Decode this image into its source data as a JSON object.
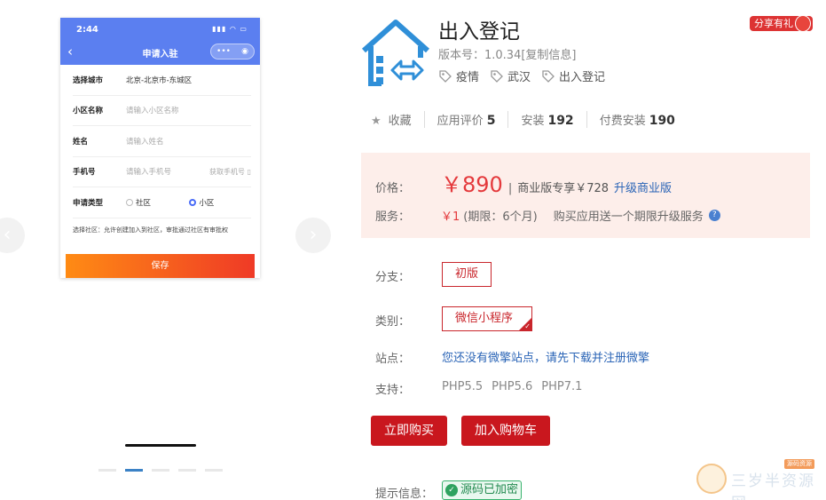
{
  "gallery": {
    "prev_arrow": "‹",
    "next_arrow": "›",
    "phone": {
      "time": "2:44",
      "status_icons": "▮▮▮ ◠ ▭",
      "back_glyph": "‹",
      "title": "申请入驻",
      "capsule_more": "•••",
      "capsule_close": "◉",
      "rows": [
        {
          "label": "选择城市",
          "value": "北京-北京市-东城区",
          "type": "value"
        },
        {
          "label": "小区名称",
          "value": "请输入小区名称",
          "type": "placeholder"
        },
        {
          "label": "姓名",
          "value": "请输入姓名",
          "type": "placeholder"
        },
        {
          "label": "手机号",
          "value": "请输入手机号",
          "type": "placeholder",
          "side": "获取手机号 ▯"
        }
      ],
      "type_row": {
        "label": "申请类型",
        "option1": "社区",
        "option2": "小区"
      },
      "note": "选择社区：允许创建加入到社区，审批通过社区有审批权",
      "save_label": "保存"
    }
  },
  "product": {
    "title": "出入登记",
    "version": "版本号：1.0.34[复制信息]",
    "tags": [
      "疫情",
      "武汉",
      "出入登记"
    ],
    "share_label": "分享有礼",
    "share_icon": "gift-icon"
  },
  "stats": {
    "favorite_glyph": "★",
    "favorite_label": "收藏",
    "rating_label": "应用评价",
    "rating_value": "5",
    "install_label": "安装",
    "install_value": "192",
    "paid_label": "付费安装",
    "paid_value": "190"
  },
  "pricing": {
    "price_label": "价格：",
    "price_value": "￥890",
    "biz_text": "商业版专享￥728",
    "upgrade_link": "升级商业版",
    "service_label": "服务：",
    "service_value": "￥1",
    "service_period": "(期限：6个月)",
    "service_desc": "购买应用送一个期限升级服务",
    "help_glyph": "?"
  },
  "options": {
    "branch_label": "分支：",
    "branch_value": "初版",
    "category_label": "类别：",
    "category_value": "微信小程序",
    "site_label": "站点：",
    "site_text": "您还没有微擎站点，请先下载并注册微擎",
    "support_label": "支持：",
    "php_versions": [
      "PHP5.5",
      "PHP5.6",
      "PHP7.1"
    ]
  },
  "actions": {
    "buy_label": "立即购买",
    "cart_label": "加入购物车"
  },
  "tip": {
    "label": "提示信息：",
    "badge_text": "源码已加密",
    "badge_glyph": "✓"
  },
  "watermark": {
    "text": "三岁半资源网",
    "tag": "源码资源"
  },
  "colors": {
    "accent_red": "#c9171e",
    "price_red": "#e4393c",
    "link_blue": "#2a64b6",
    "phone_header": "#5b7ff0",
    "logo_blue": "#2f8fd8"
  }
}
